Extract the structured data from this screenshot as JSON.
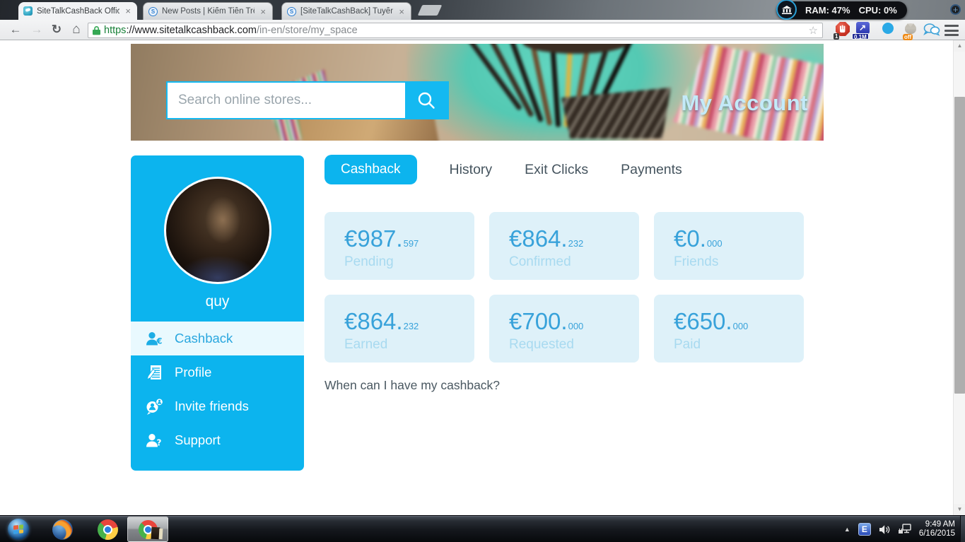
{
  "browser": {
    "tabs": [
      {
        "title": "SiteTalkCashBack Official S",
        "icon": "sitetalk-logo"
      },
      {
        "title": "New Posts | Kiếm Tiền Trê",
        "icon": "sitetalk-s-logo"
      },
      {
        "title": "[SiteTalkCashBack] Tuyển",
        "icon": "sitetalk-s-logo"
      }
    ],
    "favicon_letter": "S",
    "url": {
      "scheme": "https",
      "host": "://www.sitetalkcashback.com",
      "path": "/in-en/store/my_space"
    },
    "monitor": {
      "ram": "RAM: 47%",
      "cpu": "CPU: 0%"
    },
    "extensions": {
      "adblock_badge": "1",
      "alexa_badge": "0.1M",
      "alexa_arrow": "↗",
      "cat_badge": "off"
    }
  },
  "icons": {
    "back": "←",
    "forward": "→",
    "reload": "↻",
    "home": "⌂",
    "star": "☆",
    "close": "×",
    "plus": "+",
    "scroll_up": "▲",
    "scroll_down": "▼",
    "tray_chevron": "▲"
  },
  "header": {
    "search_placeholder": "Search online stores...",
    "title": "My Account"
  },
  "sidebar": {
    "username": "quy",
    "items": [
      {
        "label": "Cashback",
        "icon": "user-euro-icon",
        "active": true
      },
      {
        "label": "Profile",
        "icon": "document-pencil-icon",
        "active": false
      },
      {
        "label": "Invite friends",
        "icon": "invite-person-icon",
        "active": false
      },
      {
        "label": "Support",
        "icon": "user-question-icon",
        "active": false
      }
    ]
  },
  "account_tabs": [
    {
      "label": "Cashback",
      "active": true
    },
    {
      "label": "History",
      "active": false
    },
    {
      "label": "Exit Clicks",
      "active": false
    },
    {
      "label": "Payments",
      "active": false
    }
  ],
  "stats": [
    {
      "whole": "€987.",
      "fraction": "597",
      "label": "Pending"
    },
    {
      "whole": "€864.",
      "fraction": "232",
      "label": "Confirmed"
    },
    {
      "whole": "€0.",
      "fraction": "000",
      "label": "Friends"
    },
    {
      "whole": "€864.",
      "fraction": "232",
      "label": "Earned"
    },
    {
      "whole": "€700.",
      "fraction": "000",
      "label": "Requested"
    },
    {
      "whole": "€650.",
      "fraction": "000",
      "label": "Paid"
    }
  ],
  "main": {
    "faq_link": "When can I have my cashback?"
  },
  "taskbar": {
    "tray_app_letter": "E",
    "time": "9:49 AM",
    "date": "6/16/2015"
  },
  "colors": {
    "accent": "#0cb4ee",
    "card_bg": "#def1f9",
    "stat_value": "#38a2da",
    "stat_label": "#a8daf0",
    "lock_green": "#35a854"
  }
}
